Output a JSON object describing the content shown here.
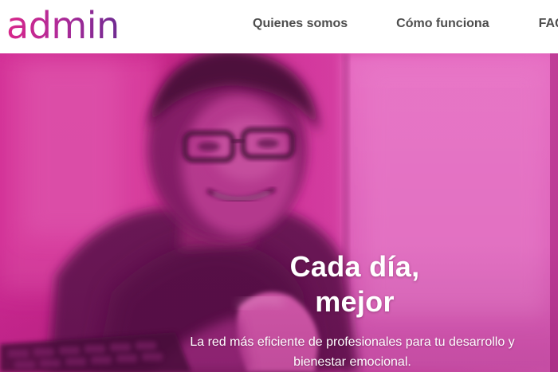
{
  "header": {
    "logo_text": "admin",
    "nav": [
      {
        "label": "Quienes somos"
      },
      {
        "label": "Cómo funciona"
      },
      {
        "label": "FAQS"
      }
    ]
  },
  "hero": {
    "title_line1": "Cada día,",
    "title_line2": "mejor",
    "subtitle_line1": "La red más eficiente de profesionales para tu desarrollo y",
    "subtitle_line2": "bienestar emocional.",
    "image_subject": "man-on-video-call-photo"
  },
  "colors": {
    "brand_magenta": "#d8288a",
    "brand_purple": "#6e2b92",
    "hero_tint": "#c21e8e",
    "nav_text": "#4d4d4d",
    "hero_text": "#ffffff"
  }
}
